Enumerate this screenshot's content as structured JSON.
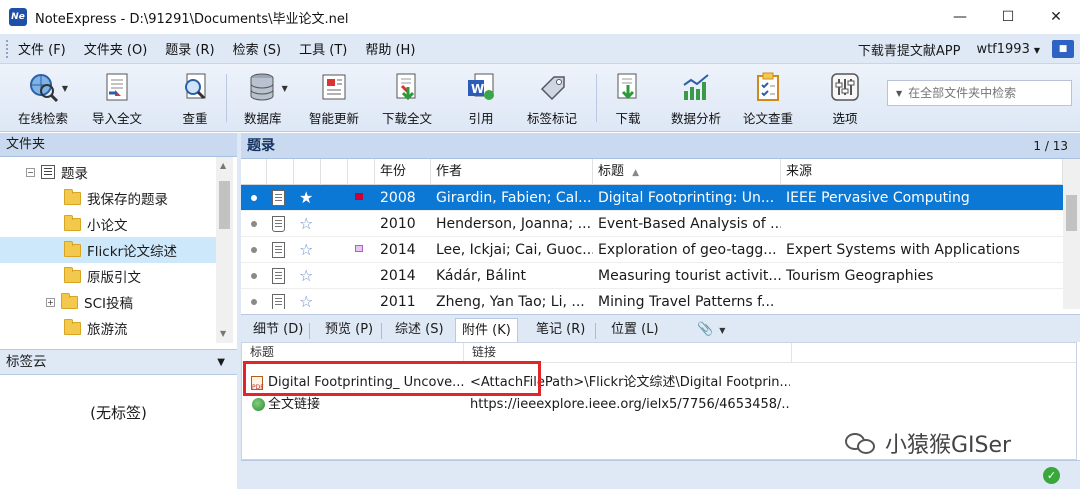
{
  "window": {
    "title": "NoteExpress - D:\\91291\\Documents\\毕业论文.nel",
    "logo_text": "Ne"
  },
  "menu": {
    "items": [
      "文件 (F)",
      "文件夹 (O)",
      "题录 (R)",
      "检索 (S)",
      "工具 (T)",
      "帮助 (H)"
    ],
    "right": {
      "download_app": "下载青提文献APP",
      "user": "wtf1993"
    }
  },
  "toolbar": {
    "buttons": [
      "在线检索",
      "导入全文",
      "查重",
      "数据库",
      "智能更新",
      "下载全文",
      "引用",
      "标签标记",
      "下载",
      "数据分析",
      "论文查重",
      "选项"
    ],
    "search_placeholder": "在全部文件夹中检索"
  },
  "left": {
    "header": "文件夹",
    "tree": [
      "题录",
      "我保存的题录",
      "小论文",
      "Flickr论文综述",
      "原版引文",
      "SCI投稿",
      "旅游流"
    ],
    "tag_cloud": {
      "header": "标签云",
      "empty": "(无标签)"
    }
  },
  "records": {
    "header": "题录",
    "pagination": "1 / 13",
    "columns": [
      "年份",
      "作者",
      "标题",
      "来源"
    ],
    "rows": [
      {
        "year": "2008",
        "author": "Girardin, Fabien; Cal...",
        "title": "Digital Footprinting: Un...",
        "source": "IEEE Pervasive Computing",
        "flag": "#cc0033"
      },
      {
        "year": "2010",
        "author": "Henderson, Joanna; ...",
        "title": "Event-Based Analysis of ...",
        "source": "",
        "flag": ""
      },
      {
        "year": "2014",
        "author": "Lee, Ickjai; Cai, Guoc...",
        "title": "Exploration of geo-tagg...",
        "source": "Expert Systems with Applications",
        "flag": "#b060c0"
      },
      {
        "year": "2014",
        "author": "Kádár, Bálint",
        "title": "Measuring tourist activit...",
        "source": "Tourism Geographies",
        "flag": ""
      },
      {
        "year": "2011",
        "author": "Zheng, Yan Tao; Li, ...",
        "title": "Mining Travel Patterns f...",
        "source": "",
        "flag": ""
      }
    ]
  },
  "tabs": [
    "细节 (D)",
    "预览 (P)",
    "综述 (S)",
    "附件 (K)",
    "笔记 (R)",
    "位置 (L)"
  ],
  "attachments": {
    "columns": [
      "标题",
      "链接"
    ],
    "rows": [
      {
        "title": "Digital Footprinting_ Uncove...",
        "link": "<AttachFilePath>\\Flickr论文综述\\Digital Footprin..."
      },
      {
        "title": "全文链接",
        "link": "https://ieeexplore.ieee.org/ielx5/7756/4653458/..."
      }
    ]
  },
  "watermark": "小猿猴GISer",
  "colors": {
    "selection": "#0a78d4",
    "highlight": "#e0262a",
    "panel": "#dfe8f5"
  }
}
